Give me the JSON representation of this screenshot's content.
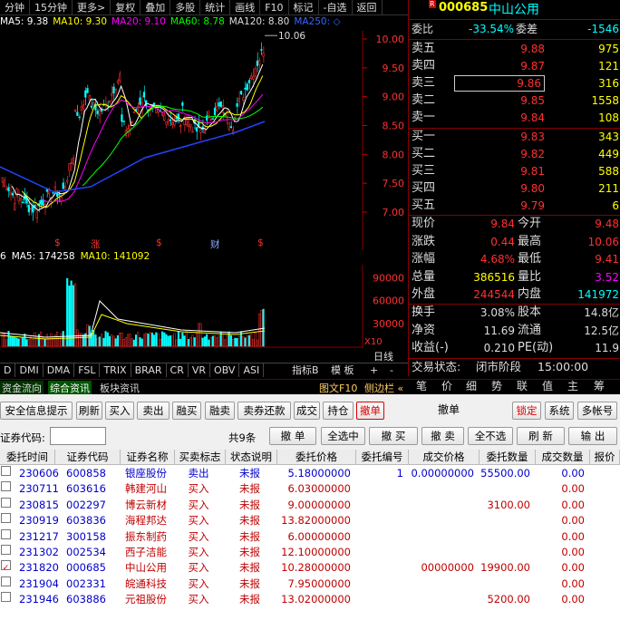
{
  "toolbar": {
    "items": [
      "分钟",
      "15分钟",
      "更多>",
      "复权",
      "叠加",
      "多股",
      "统计",
      "画线",
      "F10",
      "标记",
      "-自选",
      "返回"
    ]
  },
  "ma_legend": [
    {
      "label": "MA5: 9.38",
      "color": "#ffffff"
    },
    {
      "label": "MA10: 9.30",
      "color": "#ffff00"
    },
    {
      "label": "MA20: 9.10",
      "color": "#ff00ff"
    },
    {
      "label": "MA60: 8.78",
      "color": "#00ff00"
    },
    {
      "label": "MA120: 8.80",
      "color": "#dddddd"
    },
    {
      "label": "MA250: ◇",
      "color": "#3366ff"
    }
  ],
  "price_axis": [
    "10.00",
    "9.50",
    "9.00",
    "8.50",
    "8.00",
    "7.50",
    "7.00"
  ],
  "max_price_label": "10.06",
  "event_markers": [
    {
      "text": "$",
      "color": "#ff3030"
    },
    {
      "text": "涨",
      "color": "#ff3030"
    },
    {
      "text": "$",
      "color": "#ff3030"
    },
    {
      "text": "财",
      "color": "#88aaff"
    },
    {
      "text": "$",
      "color": "#ff3030"
    }
  ],
  "volume_legend": [
    {
      "label": "6",
      "color": "#ffffff"
    },
    {
      "label": "MA5: 174258",
      "color": "#ffffff"
    },
    {
      "label": "MA10: 141092",
      "color": "#ffff00"
    }
  ],
  "volume_axis": [
    "90000",
    "60000",
    "30000"
  ],
  "volume_unit": "X10",
  "period_label": "日线",
  "indicator_tabs": [
    "D",
    "DMI",
    "DMA",
    "FSL",
    "TRIX",
    "BRAR",
    "CR",
    "VR",
    "OBV",
    "ASI"
  ],
  "indicator_controls": [
    "指标B",
    "模 板",
    "+",
    "-"
  ],
  "func_tabs": [
    "资金流向",
    "综合资讯",
    "板块资讯"
  ],
  "side_buttons": [
    "图文F10",
    "侧边栏 «"
  ],
  "quote": {
    "code": "000685",
    "name": "中山公用",
    "r_badge": "R",
    "weibi_label": "委比",
    "weibi_value": "-33.54%",
    "weicha_label": "委差",
    "weicha_value": "-1546",
    "asks": [
      {
        "label": "卖五",
        "price": "9.88",
        "vol": "975"
      },
      {
        "label": "卖四",
        "price": "9.87",
        "vol": "121"
      },
      {
        "label": "卖三",
        "price": "9.86",
        "vol": "316"
      },
      {
        "label": "卖二",
        "price": "9.85",
        "vol": "1558"
      },
      {
        "label": "卖一",
        "price": "9.84",
        "vol": "108"
      }
    ],
    "bids": [
      {
        "label": "买一",
        "price": "9.83",
        "vol": "343"
      },
      {
        "label": "买二",
        "price": "9.82",
        "vol": "449"
      },
      {
        "label": "买三",
        "price": "9.81",
        "vol": "588"
      },
      {
        "label": "买四",
        "price": "9.80",
        "vol": "211"
      },
      {
        "label": "买五",
        "price": "9.79",
        "vol": "6"
      }
    ],
    "stats": [
      {
        "l1": "现价",
        "v1": "9.84",
        "c1": "#ff3030",
        "l2": "今开",
        "v2": "9.48",
        "c2": "#ff3030"
      },
      {
        "l1": "涨跌",
        "v1": "0.44",
        "c1": "#ff3030",
        "l2": "最高",
        "v2": "10.06",
        "c2": "#ff3030"
      },
      {
        "l1": "涨幅",
        "v1": "4.68%",
        "c1": "#ff3030",
        "l2": "最低",
        "v2": "9.41",
        "c2": "#ff3030"
      },
      {
        "l1": "总量",
        "v1": "386516",
        "c1": "#ffff00",
        "l2": "量比",
        "v2": "3.52",
        "c2": "#ff00ff"
      },
      {
        "l1": "外盘",
        "v1": "244544",
        "c1": "#ff3030",
        "l2": "内盘",
        "v2": "141972",
        "c2": "#00ffff"
      }
    ],
    "stats2": [
      {
        "l1": "换手",
        "v1": "3.08%",
        "l2": "股本",
        "v2": "14.8亿"
      },
      {
        "l1": "净资",
        "v1": "11.69",
        "l2": "流通",
        "v2": "12.5亿"
      },
      {
        "l1": "收益(-)",
        "v1": "0.210",
        "l2": "PE(动)",
        "v2": "11.9"
      }
    ],
    "status_label": "交易状态:",
    "status_value": "闭市阶段",
    "status_time": "15:00:00",
    "tabs": [
      "笔",
      "价",
      "细",
      "势",
      "联",
      "值",
      "主",
      "筹"
    ]
  },
  "trade": {
    "buttons": [
      "安全信息提示",
      "刷新",
      "买入",
      "卖出",
      "融买",
      "融卖",
      "卖券还款",
      "成交",
      "持仓",
      "撤单"
    ],
    "title": "撤单",
    "right_buttons": [
      "锁定",
      "系统",
      "多帐号"
    ],
    "code_label": "证券代码:",
    "count_text": "共9条",
    "actions": [
      "撤 单",
      "全选中",
      "撤 买",
      "撤 卖",
      "全不选",
      "刷 新",
      "输 出"
    ],
    "headers": [
      "委托时间",
      "证券代码",
      "证券名称",
      "买卖标志",
      "状态说明",
      "委托价格",
      "委托编号",
      "成交价格",
      "委托数量",
      "成交数量",
      "报价"
    ],
    "rows": [
      {
        "time": "230606",
        "code": "600858",
        "name": "银座股份",
        "side": "卖出",
        "status": "未报",
        "price": "5.18000000",
        "no": "1",
        "deal": "0.00000000",
        "qty": "55500.00",
        "dqty": "0.00",
        "checked": ""
      },
      {
        "time": "230711",
        "code": "603616",
        "name": "韩建河山",
        "side": "买入",
        "status": "未报",
        "price": "6.03000000",
        "no": "",
        "deal": "",
        "qty": "",
        "dqty": "0.00",
        "checked": ""
      },
      {
        "time": "230815",
        "code": "002297",
        "name": "博云新材",
        "side": "买入",
        "status": "未报",
        "price": "9.00000000",
        "no": "",
        "deal": "",
        "qty": "3100.00",
        "dqty": "0.00",
        "checked": ""
      },
      {
        "time": "230919",
        "code": "603836",
        "name": "海程邦达",
        "side": "买入",
        "status": "未报",
        "price": "13.82000000",
        "no": "",
        "deal": "",
        "qty": "",
        "dqty": "0.00",
        "checked": ""
      },
      {
        "time": "231217",
        "code": "300158",
        "name": "振东制药",
        "side": "买入",
        "status": "未报",
        "price": "6.00000000",
        "no": "",
        "deal": "",
        "qty": "",
        "dqty": "0.00",
        "checked": ""
      },
      {
        "time": "231302",
        "code": "002534",
        "name": "西子洁能",
        "side": "买入",
        "status": "未报",
        "price": "12.10000000",
        "no": "",
        "deal": "",
        "qty": "",
        "dqty": "0.00",
        "checked": ""
      },
      {
        "time": "231820",
        "code": "000685",
        "name": "中山公用",
        "side": "买入",
        "status": "未报",
        "price": "10.28000000",
        "no": "",
        "deal": "00000000",
        "qty": "19900.00",
        "dqty": "0.00",
        "checked": "✓"
      },
      {
        "time": "231904",
        "code": "002331",
        "name": "皖通科技",
        "side": "买入",
        "status": "未报",
        "price": "7.95000000",
        "no": "",
        "deal": "",
        "qty": "",
        "dqty": "0.00",
        "checked": ""
      },
      {
        "time": "231946",
        "code": "603886",
        "name": "元祖股份",
        "side": "买入",
        "status": "未报",
        "price": "13.02000000",
        "no": "",
        "deal": "",
        "qty": "5200.00",
        "dqty": "0.00",
        "checked": ""
      }
    ]
  }
}
